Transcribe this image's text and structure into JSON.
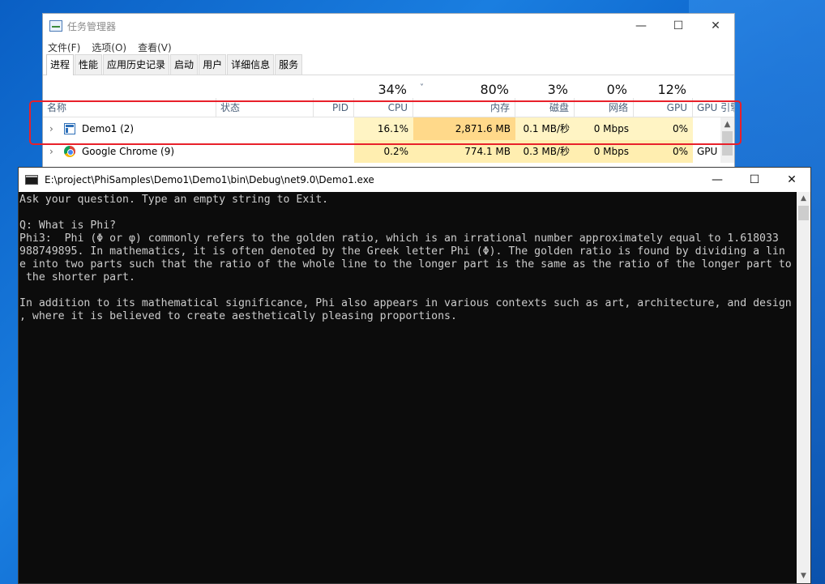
{
  "task_manager": {
    "title": "任务管理器",
    "controls": {
      "minimize": "—",
      "maximize": "☐",
      "close": "✕"
    },
    "menu": [
      "文件(F)",
      "选项(O)",
      "查看(V)"
    ],
    "tabs": [
      "进程",
      "性能",
      "应用历史记录",
      "启动",
      "用户",
      "详细信息",
      "服务"
    ],
    "active_tab": "进程",
    "usage": {
      "cpu": "34%",
      "memory": "80%",
      "disk": "3%",
      "network": "0%",
      "gpu": "12%"
    },
    "sort_indicator": "˅",
    "columns": [
      "名称",
      "状态",
      "PID",
      "CPU",
      "内存",
      "磁盘",
      "网络",
      "GPU",
      "GPU 引擎"
    ],
    "rows": [
      {
        "name": "Demo1 (2)",
        "icon": "console-app-icon",
        "status": "",
        "pid": "",
        "cpu": "16.1%",
        "memory": "2,871.6 MB",
        "disk": "0.1 MB/秒",
        "network": "0 Mbps",
        "gpu": "0%",
        "gpu_engine": ""
      },
      {
        "name": "Google Chrome (9)",
        "icon": "chrome-icon",
        "status": "",
        "pid": "",
        "cpu": "0.2%",
        "memory": "774.1 MB",
        "disk": "0.3 MB/秒",
        "network": "0 Mbps",
        "gpu": "0%",
        "gpu_engine": "GPU"
      }
    ],
    "highlight_color": "#e8202a"
  },
  "console": {
    "title": "E:\\project\\PhiSamples\\Demo1\\Demo1\\bin\\Debug\\net9.0\\Demo1.exe",
    "controls": {
      "minimize": "—",
      "maximize": "☐",
      "close": "✕"
    },
    "lines": [
      "Ask your question. Type an empty string to Exit.",
      "",
      "Q: What is Phi?",
      "Phi3:  Phi (Φ or φ) commonly refers to the golden ratio, which is an irrational number approximately equal to 1.618033",
      "988749895. In mathematics, it is often denoted by the Greek letter Phi (Φ). The golden ratio is found by dividing a lin",
      "e into two parts such that the ratio of the whole line to the longer part is the same as the ratio of the longer part to",
      " the shorter part.",
      "",
      "In addition to its mathematical significance, Phi also appears in various contexts such as art, architecture, and design",
      ", where it is believed to create aesthetically pleasing proportions."
    ]
  }
}
